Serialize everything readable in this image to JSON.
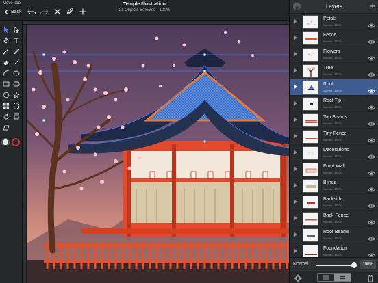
{
  "topbar": {
    "tool_name": "Move Tool",
    "back_label": "Back",
    "doc_title": "Temple Illustration",
    "doc_subtitle": "21 Objects Selected - 100%"
  },
  "toolbar": {
    "tools": [
      "select-arrow",
      "direct-select-arrow",
      "pen",
      "text",
      "brush",
      "pencil",
      "eraser",
      "line",
      "arc",
      "ellipse",
      "rectangle",
      "rounded-rectangle",
      "circle",
      "star",
      "grid",
      "transform",
      "rotate",
      "mirror",
      "shear"
    ],
    "fill_color": "#e8e8ea",
    "stroke_color": "#c23a3a"
  },
  "layers_panel": {
    "title": "Layers",
    "layers": [
      {
        "name": "Petals",
        "meta": "Normal - 100%",
        "selected": false,
        "thumb": "petals"
      },
      {
        "name": "Fence",
        "meta": "Normal - 100%",
        "selected": false,
        "thumb": "fence"
      },
      {
        "name": "Flowers",
        "meta": "Normal - 100%",
        "selected": false,
        "thumb": "flowers"
      },
      {
        "name": "Tree",
        "meta": "Normal - 100%",
        "selected": false,
        "thumb": "tree"
      },
      {
        "name": "Roof",
        "meta": "Normal - 100%",
        "selected": true,
        "thumb": "roof"
      },
      {
        "name": "Roof Tip",
        "meta": "Normal - 100%",
        "selected": false,
        "thumb": "roof-tip"
      },
      {
        "name": "Top Beams",
        "meta": "Normal - 100%",
        "selected": false,
        "thumb": "beams"
      },
      {
        "name": "Tiny Fence",
        "meta": "Normal - 100%",
        "selected": false,
        "thumb": "tiny-fence"
      },
      {
        "name": "Decorations",
        "meta": "Normal - 100%",
        "selected": false,
        "thumb": "decorations"
      },
      {
        "name": "Front Wall",
        "meta": "Normal - 100%",
        "selected": false,
        "thumb": "front-wall"
      },
      {
        "name": "Blinds",
        "meta": "Normal - 100%",
        "selected": false,
        "thumb": "blinds"
      },
      {
        "name": "Backside",
        "meta": "Normal - 100%",
        "selected": false,
        "thumb": "backside"
      },
      {
        "name": "Back Fence",
        "meta": "Normal - 100%",
        "selected": false,
        "thumb": "back-fence"
      },
      {
        "name": "Roof Beams",
        "meta": "Normal - 100%",
        "selected": false,
        "thumb": "roof-beams"
      },
      {
        "name": "Foundation",
        "meta": "Normal - 100%",
        "selected": false,
        "thumb": "foundation"
      }
    ],
    "blend_mode": "Normal",
    "opacity_value": "100%",
    "opacity_fraction": 1.0
  },
  "colors": {
    "accent": "#3e5c8f",
    "selection": "#2f6fe0",
    "temple_red": "#e0452a",
    "sky_top": "#5a3f5e",
    "sky_bottom": "#e8a07a"
  }
}
